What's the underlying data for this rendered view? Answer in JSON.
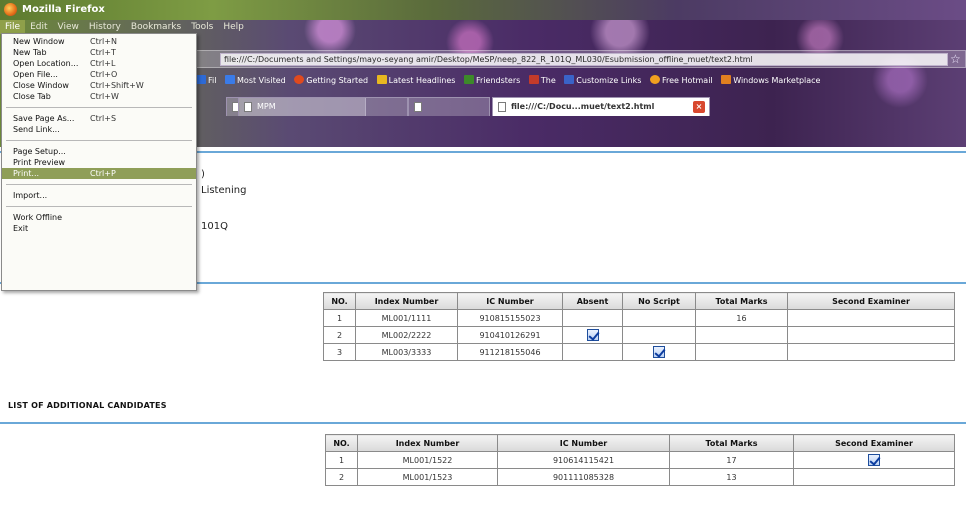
{
  "window": {
    "title": "Mozilla Firefox"
  },
  "menubar": {
    "items": [
      "File",
      "Edit",
      "View",
      "History",
      "Bookmarks",
      "Tools",
      "Help"
    ]
  },
  "navbar": {
    "url": "file:///C:/Documents and Settings/mayo-seyang amir/Desktop/MeSP/neep_822_R_101Q_ML030/Esubmission_offline_muet/text2.html"
  },
  "bookmarks": {
    "items": [
      {
        "label": "Fil",
        "color": "#2d6ad6"
      },
      {
        "label": "Most Visited",
        "color": "#3a7be8"
      },
      {
        "label": "Getting Started",
        "color": "#e04a1e"
      },
      {
        "label": "Latest Headlines",
        "color": "#e8b820"
      },
      {
        "label": "Friendsters",
        "color": "#3d8a2a"
      },
      {
        "label": "The",
        "color": "#c43b2a"
      },
      {
        "label": "Customize Links",
        "color": "#3a63c8"
      },
      {
        "label": "Free Hotmail",
        "color": "#f0a020"
      },
      {
        "label": "Windows Marketplace",
        "color": "#e08020"
      }
    ]
  },
  "tabs": [
    {
      "label": "",
      "dim": true
    },
    {
      "label": "MPM",
      "dim": true
    },
    {
      "label": "file:///C:/Docu...muet/text2.html",
      "dim": false
    }
  ],
  "file_menu": {
    "items": [
      {
        "label": "New Window",
        "shortcut": "Ctrl+N"
      },
      {
        "label": "New Tab",
        "shortcut": "Ctrl+T"
      },
      {
        "label": "Open Location...",
        "shortcut": "Ctrl+L"
      },
      {
        "label": "Open File...",
        "shortcut": "Ctrl+O"
      },
      {
        "label": "Close Window",
        "shortcut": "Ctrl+Shift+W"
      },
      {
        "label": "Close Tab",
        "shortcut": "Ctrl+W"
      },
      {
        "label": "Save Page As...",
        "shortcut": "Ctrl+S"
      },
      {
        "label": "Send Link...",
        "shortcut": ""
      },
      {
        "label": "Page Setup...",
        "shortcut": ""
      },
      {
        "label": "Print Preview",
        "shortcut": ""
      },
      {
        "label": "Print...",
        "shortcut": "Ctrl+P",
        "highlighted": true
      },
      {
        "label": "Import...",
        "shortcut": ""
      },
      {
        "label": "Work Offline",
        "shortcut": ""
      },
      {
        "label": "Exit",
        "shortcut": ""
      }
    ]
  },
  "page": {
    "info_fragments": [
      ")",
      "Listening",
      "101Q"
    ],
    "candidates_table": {
      "headers": [
        "NO.",
        "Index Number",
        "IC Number",
        "Absent",
        "No Script",
        "Total Marks",
        "Second Examiner"
      ],
      "rows": [
        {
          "no": "1",
          "index": "ML001/1111",
          "ic": "910815155023",
          "absent": false,
          "no_script": false,
          "total": "16",
          "second": false
        },
        {
          "no": "2",
          "index": "ML002/2222",
          "ic": "910410126291",
          "absent": true,
          "no_script": false,
          "total": "",
          "second": false
        },
        {
          "no": "3",
          "index": "ML003/3333",
          "ic": "911218155046",
          "absent": false,
          "no_script": true,
          "total": "",
          "second": false
        }
      ]
    },
    "additional_title": "LIST OF ADDITIONAL CANDIDATES",
    "additional_table": {
      "headers": [
        "NO.",
        "Index Number",
        "IC Number",
        "Total Marks",
        "Second Examiner"
      ],
      "rows": [
        {
          "no": "1",
          "index": "ML001/1522",
          "ic": "910614115421",
          "total": "17",
          "second": true
        },
        {
          "no": "2",
          "index": "ML001/1523",
          "ic": "901111085328",
          "total": "13",
          "second": false
        }
      ]
    }
  }
}
